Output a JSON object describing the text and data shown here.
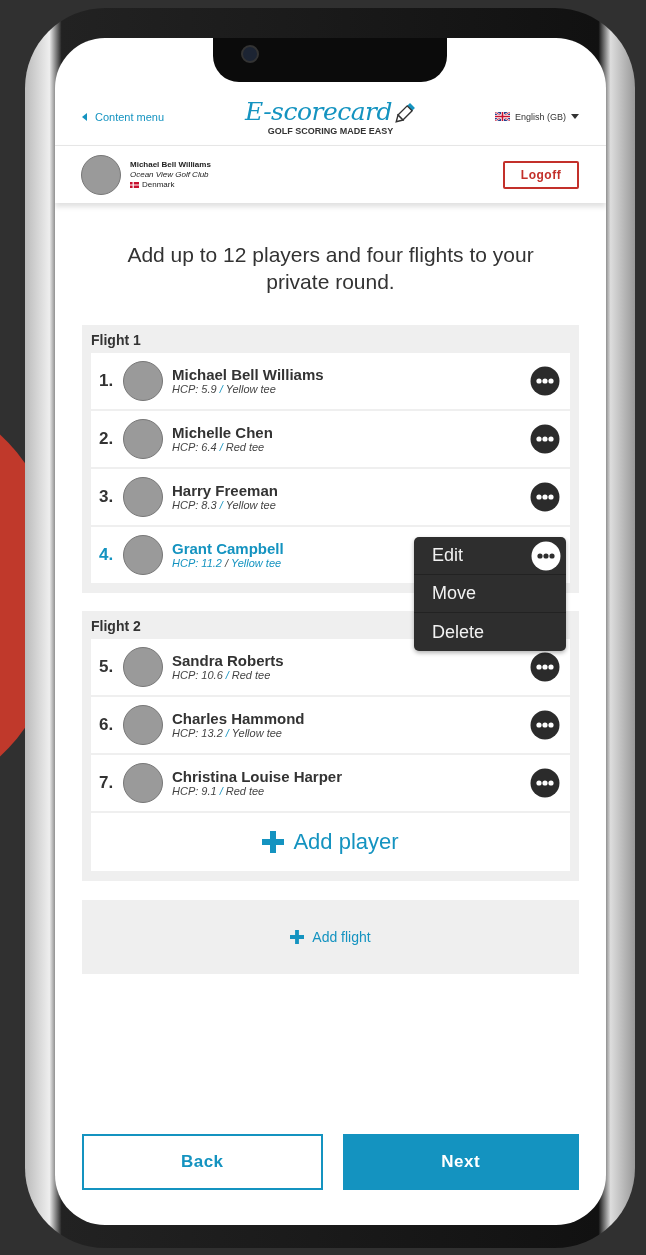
{
  "header": {
    "back_link": "Content menu",
    "logo_text": "E-scorecard",
    "tagline": "GOLF SCORING MADE EASY",
    "language": "English (GB)"
  },
  "user": {
    "name": "Michael Bell Williams",
    "club": "Ocean View Golf Club",
    "country": "Denmark",
    "logoff": "Logoff"
  },
  "heading": "Add up to 12 players and four flights to your private round.",
  "flights": [
    {
      "title": "Flight 1",
      "players": [
        {
          "number": "1.",
          "name": "Michael Bell Williams",
          "hcp": "HCP: 5.9",
          "separator": "/",
          "tee": "Yellow tee",
          "selected": false,
          "menu_open": false
        },
        {
          "number": "2.",
          "name": "Michelle Chen",
          "hcp": "HCP: 6.4",
          "separator": "/",
          "tee": "Red tee",
          "selected": false,
          "menu_open": false
        },
        {
          "number": "3.",
          "name": "Harry Freeman",
          "hcp": "HCP: 8.3",
          "separator": "/",
          "tee": "Yellow tee",
          "selected": false,
          "menu_open": false
        },
        {
          "number": "4.",
          "name": "Grant Campbell",
          "hcp": "HCP: 11.2",
          "separator": "/",
          "tee": "Yellow tee",
          "selected": true,
          "menu_open": true
        }
      ]
    },
    {
      "title": "Flight 2",
      "add_player": "Add player",
      "players": [
        {
          "number": "5.",
          "name": "Sandra Roberts",
          "hcp": "HCP: 10.6",
          "separator": "/",
          "tee": "Red tee",
          "selected": false,
          "menu_open": false
        },
        {
          "number": "6.",
          "name": "Charles Hammond",
          "hcp": "HCP: 13.2",
          "separator": "/",
          "tee": "Yellow tee",
          "selected": false,
          "menu_open": false
        },
        {
          "number": "7.",
          "name": "Christina Louise Harper",
          "hcp": "HCP: 9.1",
          "separator": "/",
          "tee": "Red tee",
          "selected": false,
          "menu_open": false
        }
      ]
    }
  ],
  "player_menu": [
    "Edit",
    "Move",
    "Delete"
  ],
  "add_flight": "Add flight",
  "buttons": {
    "back": "Back",
    "next": "Next"
  }
}
